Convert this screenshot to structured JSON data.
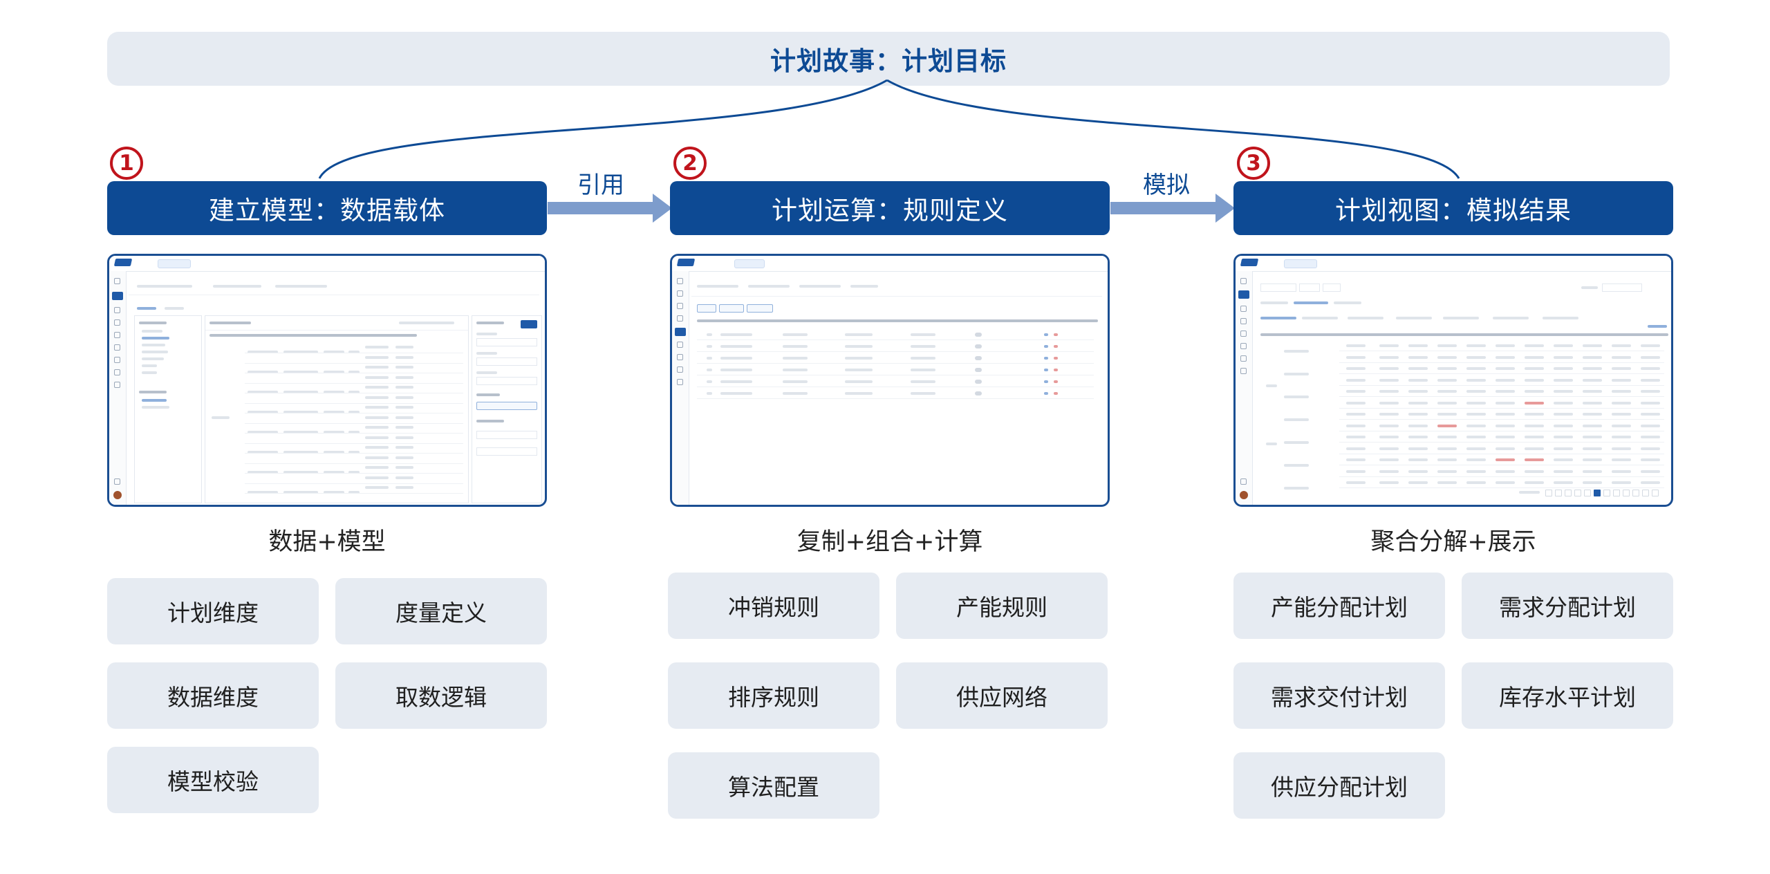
{
  "title": "计划故事：计划目标",
  "stages": [
    {
      "number": "1",
      "header": "建立模型：数据载体",
      "subtitle": "数据+模型",
      "items": [
        "计划维度",
        "度量定义",
        "数据维度",
        "取数逻辑",
        "模型校验"
      ]
    },
    {
      "number": "2",
      "header": "计划运算：规则定义",
      "subtitle": "复制+组合+计算",
      "items": [
        "冲销规则",
        "产能规则",
        "排序规则",
        "供应网络",
        "算法配置"
      ]
    },
    {
      "number": "3",
      "header": "计划视图：模拟结果",
      "subtitle": "聚合分解+展示",
      "items": [
        "产能分配计划",
        "需求分配计划",
        "需求交付计划",
        "库存水平计划",
        "供应分配计划"
      ]
    }
  ],
  "arrows": [
    {
      "label": "引用"
    },
    {
      "label": "模拟"
    }
  ],
  "colors": {
    "header": "#0d4a94",
    "title_text": "#0d4a94",
    "badge": "#c0141c",
    "panel": "#e6ebf2",
    "arrow": "#7d9ccc"
  },
  "screenshots": [
    {
      "icon": "modeling-ui-screenshot"
    },
    {
      "icon": "rule-config-ui-screenshot"
    },
    {
      "icon": "plan-view-ui-screenshot"
    }
  ]
}
